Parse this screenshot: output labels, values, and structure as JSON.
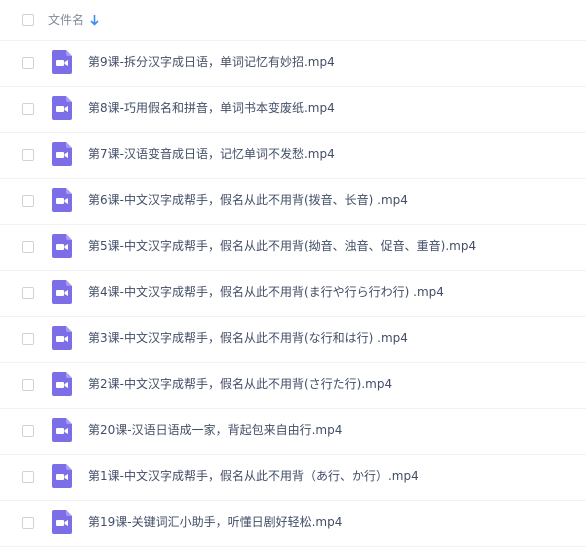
{
  "header": {
    "column_label": "文件名",
    "sort_icon": "arrow-down-icon"
  },
  "file_icon": "video-file-icon",
  "accent_color": "#7c6ee6",
  "files": [
    {
      "name": "第9课-拆分汉字成日语，单词记忆有妙招.mp4"
    },
    {
      "name": "第8课-巧用假名和拼音，单词书本变废纸.mp4"
    },
    {
      "name": "第7课-汉语变音成日语，记忆单词不发愁.mp4"
    },
    {
      "name": "第6课-中文汉字成帮手，假名从此不用背(拨音、长音) .mp4"
    },
    {
      "name": "第5课-中文汉字成帮手，假名从此不用背(拗音、浊音、促音、重音).mp4"
    },
    {
      "name": "第4课-中文汉字成帮手，假名从此不用背(ま行や行ら行わ行) .mp4"
    },
    {
      "name": "第3课-中文汉字成帮手，假名从此不用背(な行和は行) .mp4"
    },
    {
      "name": "第2课-中文汉字成帮手，假名从此不用背(さ行た行).mp4"
    },
    {
      "name": "第20课-汉语日语成一家，背起包来自由行.mp4"
    },
    {
      "name": "第1课-中文汉字成帮手，假名从此不用背（あ行、か行）.mp4"
    },
    {
      "name": "第19课-关键词汇小助手，听懂日剧好轻松.mp4"
    }
  ]
}
